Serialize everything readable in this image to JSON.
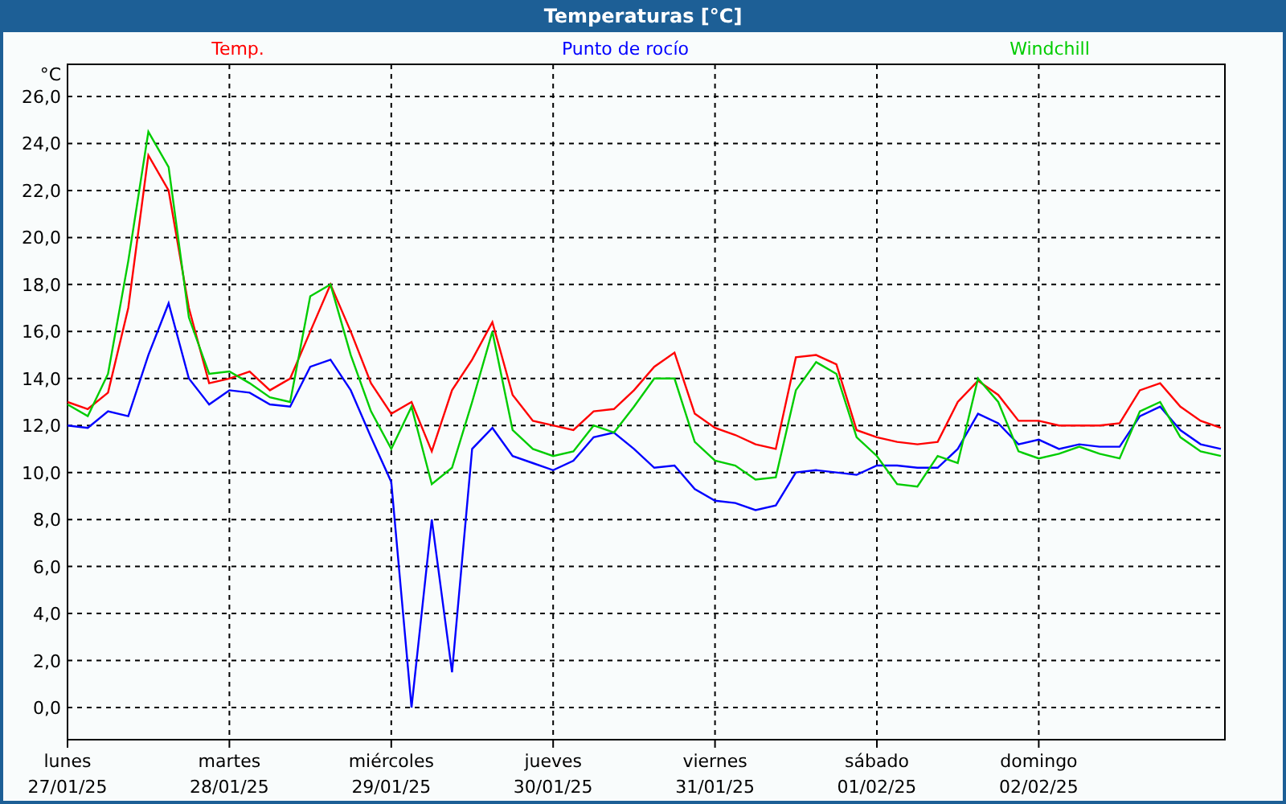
{
  "window": {
    "title": "Temperaturas [°C]"
  },
  "chart": {
    "chart_data": {
      "type": "line",
      "ylabel": "°C",
      "categories": [
        "lunes\n27/01/25",
        null,
        null,
        null,
        null,
        null,
        null,
        null,
        "martes\n28/01/25",
        null,
        null,
        null,
        null,
        null,
        null,
        null,
        "miércoles\n29/01/25",
        null,
        null,
        null,
        null,
        null,
        null,
        null,
        "jueves\n30/01/25",
        null,
        null,
        null,
        null,
        null,
        null,
        null,
        "viernes\n31/01/25",
        null,
        null,
        null,
        null,
        null,
        null,
        null,
        "sábado\n01/02/25",
        null,
        null,
        null,
        null,
        null,
        null,
        null,
        "domingo\n02/02/25",
        null,
        null,
        null,
        null,
        null,
        null,
        null,
        null,
        null
      ],
      "series": [
        {
          "name": "Temp.",
          "color": "#ff0000",
          "values": [
            13.0,
            12.7,
            13.4,
            17.0,
            23.5,
            22.0,
            17.0,
            13.8,
            14.0,
            14.3,
            13.5,
            14.0,
            16.0,
            18.0,
            16.0,
            13.8,
            12.5,
            13.0,
            10.9,
            13.5,
            14.8,
            16.4,
            13.3,
            12.2,
            12.0,
            11.8,
            12.6,
            12.7,
            13.5,
            14.5,
            15.1,
            12.5,
            11.9,
            11.6,
            11.2,
            11.0,
            14.9,
            15.0,
            14.6,
            11.8,
            11.5,
            11.3,
            11.2,
            11.3,
            13.0,
            13.9,
            13.3,
            12.2,
            12.2,
            12.0,
            12.0,
            12.0,
            12.1,
            13.5,
            13.8,
            12.8,
            12.2,
            11.9
          ]
        },
        {
          "name": "Punto de rocío",
          "color": "#0000ff",
          "values": [
            12.0,
            11.9,
            12.6,
            12.4,
            15.0,
            17.2,
            14.0,
            12.9,
            13.5,
            13.4,
            12.9,
            12.8,
            14.5,
            14.8,
            13.5,
            11.5,
            9.6,
            0.0,
            8.0,
            1.5,
            11.0,
            11.9,
            10.7,
            10.4,
            10.1,
            10.5,
            11.5,
            11.7,
            11.0,
            10.2,
            10.3,
            9.3,
            8.8,
            8.7,
            8.4,
            8.6,
            10.0,
            10.1,
            10.0,
            9.9,
            10.3,
            10.3,
            10.2,
            10.2,
            11.0,
            12.5,
            12.1,
            11.2,
            11.4,
            11.0,
            11.2,
            11.1,
            11.1,
            12.4,
            12.8,
            11.8,
            11.2,
            11.0
          ]
        },
        {
          "name": "Windchill",
          "color": "#00cc00",
          "values": [
            12.9,
            12.4,
            14.2,
            19.0,
            24.5,
            23.0,
            16.6,
            14.2,
            14.3,
            13.8,
            13.2,
            13.0,
            17.5,
            18.0,
            15.0,
            12.6,
            11.0,
            12.8,
            9.5,
            10.2,
            13.0,
            16.0,
            11.8,
            11.0,
            10.7,
            10.9,
            12.0,
            11.7,
            12.8,
            14.0,
            14.0,
            11.3,
            10.5,
            10.3,
            9.7,
            9.8,
            13.5,
            14.7,
            14.2,
            11.5,
            10.7,
            9.5,
            9.4,
            10.7,
            10.4,
            14.0,
            13.0,
            10.9,
            10.6,
            10.8,
            11.1,
            10.8,
            10.6,
            12.6,
            13.0,
            11.5,
            10.9,
            10.7
          ]
        }
      ],
      "grid": true,
      "ylim": [
        -1.37,
        27.37
      ],
      "yticks": [
        {
          "value": 0,
          "label": "0,0"
        },
        {
          "value": 2,
          "label": "2,0"
        },
        {
          "value": 4,
          "label": "4,0"
        },
        {
          "value": 6,
          "label": "6,0"
        },
        {
          "value": 8,
          "label": "8,0"
        },
        {
          "value": 10,
          "label": "10,0"
        },
        {
          "value": 12,
          "label": "12,0"
        },
        {
          "value": 14,
          "label": "14,0"
        },
        {
          "value": 16,
          "label": "16,0"
        },
        {
          "value": 18,
          "label": "18,0"
        },
        {
          "value": 20,
          "label": "20,0"
        },
        {
          "value": 22,
          "label": "22,0"
        },
        {
          "value": 24,
          "label": "24,0"
        },
        {
          "value": 26,
          "label": "26,0"
        }
      ]
    }
  }
}
